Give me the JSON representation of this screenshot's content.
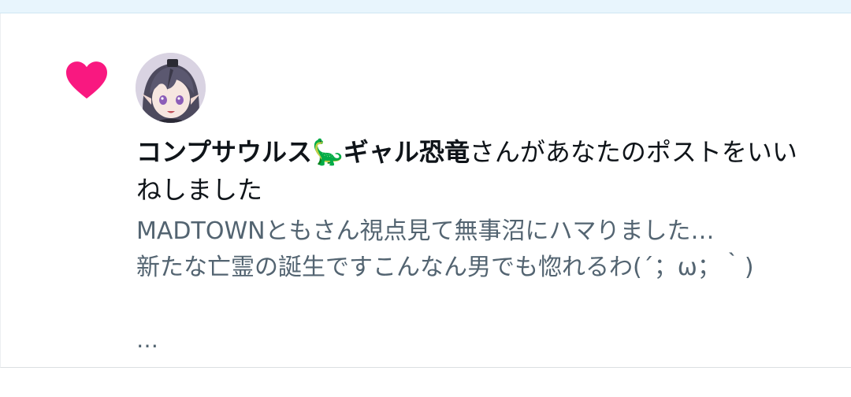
{
  "notification": {
    "type_icon": "heart-icon",
    "type_color": "#f91880",
    "avatar_icon": "avatar",
    "user_name": "コンプサウルス",
    "user_emoji": "🦕",
    "user_suffix": "ギャル恐竜",
    "action_text": "さんがあなたのポストをいいねしました",
    "post_preview": "MADTOWNともさん視点見て無事沼にハマりました…\n新たな亡霊の誕生ですこんなん男でも惚れるわ(´；ω；｀)",
    "post_more": "…"
  },
  "colors": {
    "text_primary": "#0f1419",
    "text_secondary": "#536471",
    "top_strip": "#e8f5fd"
  }
}
